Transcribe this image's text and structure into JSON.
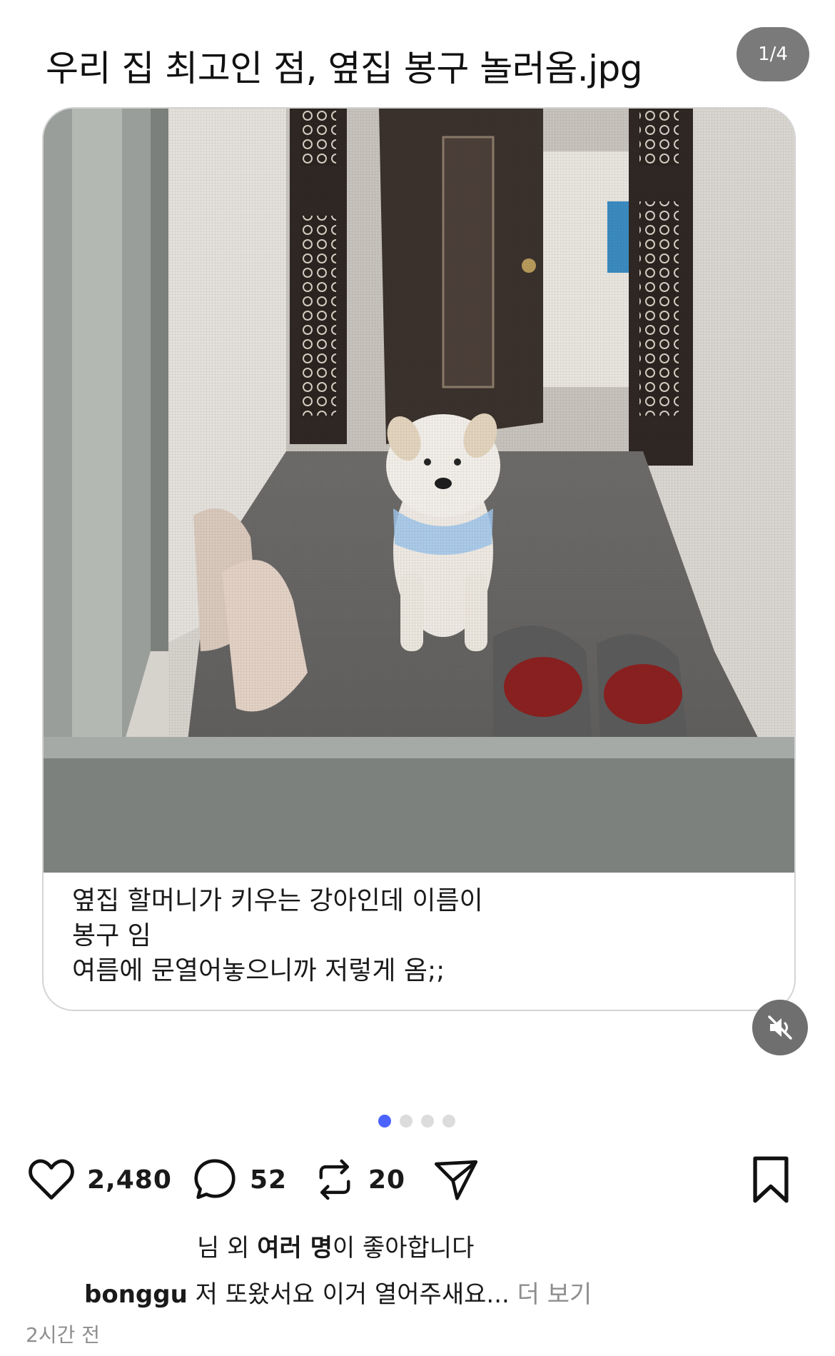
{
  "post": {
    "title": "우리 집 최고인 점, 옆집 봉구 놀러옴.jpg",
    "page_indicator": "1/4",
    "caption_lines": [
      "옆집 할머니가 키우는 강아인데 이름이",
      "봉구 임",
      "여름에 문열어놓으니까 저렇게 옴;;"
    ],
    "carousel": {
      "total": 4,
      "current": 1
    }
  },
  "actions": {
    "likes": "2,480",
    "comments": "52",
    "reposts": "20"
  },
  "likes_text": {
    "prefix": "님 외 ",
    "bold": "여러 명",
    "suffix": "이 좋아합니다"
  },
  "comment": {
    "user": "bonggu",
    "text": " 저 또왔서요 이거 열어주새요...",
    "more": " 더 보기"
  },
  "timestamp": "2시간 전",
  "icons": [
    "heart-icon",
    "comment-bubble-icon",
    "repost-icon",
    "send-icon",
    "bookmark-icon",
    "mute-icon"
  ],
  "colors": {
    "active_dot": "#4c63ff",
    "pill_bg": "#7a7a7a"
  }
}
